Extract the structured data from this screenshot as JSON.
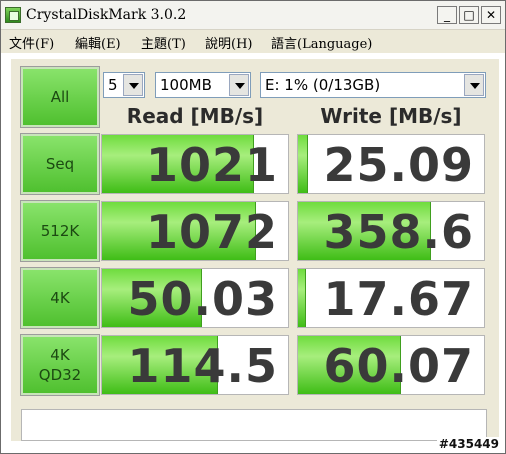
{
  "window": {
    "title": "CrystalDiskMark 3.0.2",
    "buttons": {
      "minimize": "_",
      "maximize": "□",
      "close": "✕"
    }
  },
  "menu": {
    "items": [
      "文件(F)",
      "編輯(E)",
      "主題(T)",
      "說明(H)",
      "語言(Language)"
    ]
  },
  "controls": {
    "all_label": "All",
    "runs": "5",
    "size": "100MB",
    "drive": "E: 1% (0/13GB)"
  },
  "headers": {
    "read": "Read [MB/s]",
    "write": "Write [MB/s]"
  },
  "rows": [
    {
      "label": "Seq",
      "read": "1021",
      "write": "25.09",
      "read_fill": 0.81,
      "write_fill": 0.05
    },
    {
      "label": "512K",
      "read": "1072",
      "write": "358.6",
      "read_fill": 0.82,
      "write_fill": 0.71
    },
    {
      "label": "4K",
      "read": "50.03",
      "write": "17.67",
      "read_fill": 0.53,
      "write_fill": 0.04
    },
    {
      "label_line1": "4K",
      "label_line2": "QD32",
      "read": "114.5",
      "write": "60.07",
      "read_fill": 0.62,
      "write_fill": 0.55
    }
  ],
  "comment": "",
  "watermark": "#435449",
  "colors": {
    "accent_green": "#4fc02f",
    "background": "#ece9d8"
  }
}
